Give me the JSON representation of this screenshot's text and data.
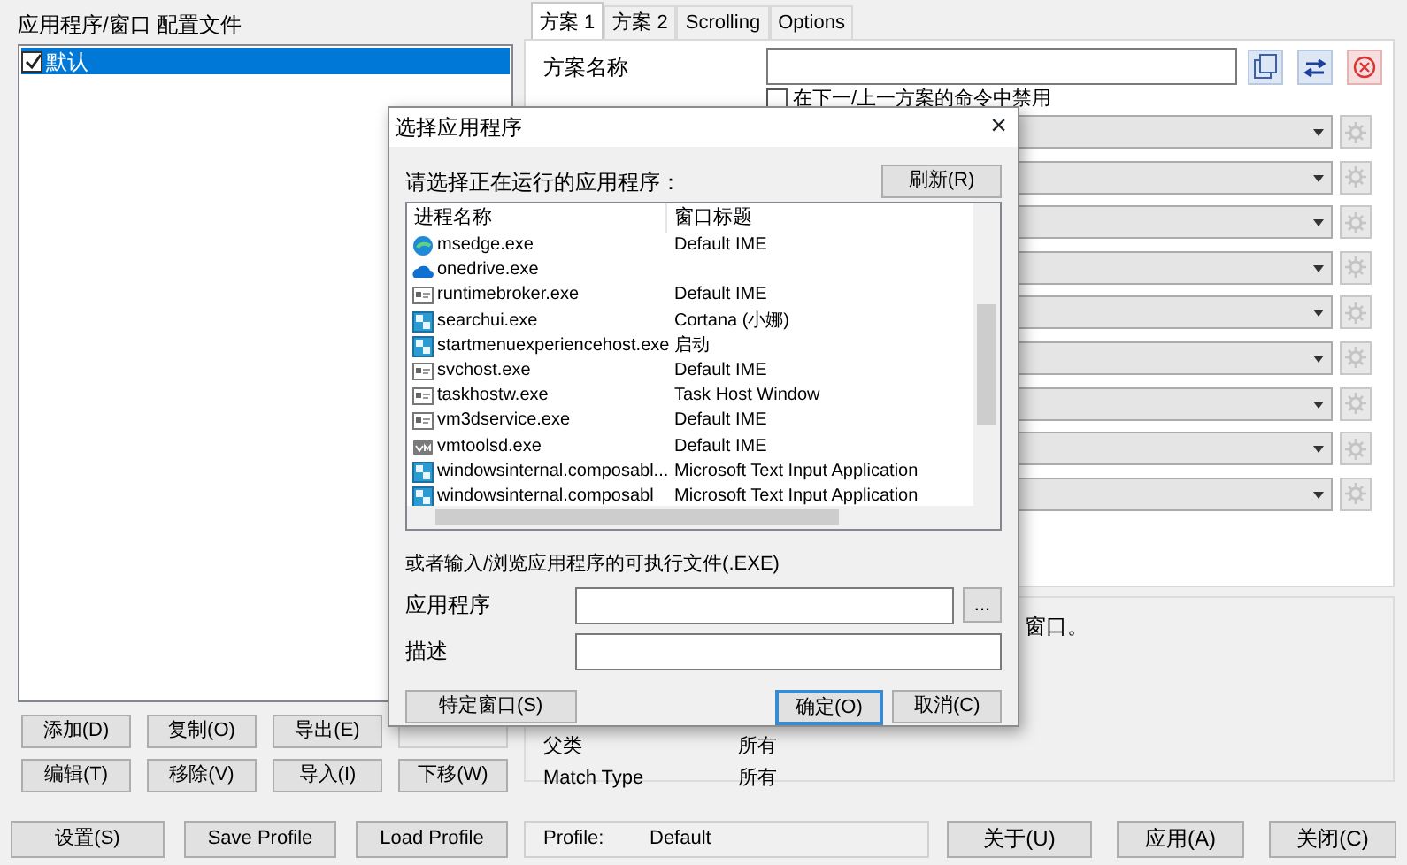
{
  "left_panel": {
    "title": "应用程序/窗口 配置文件",
    "profiles": [
      {
        "label": "默认",
        "checked": true,
        "selected": true
      }
    ],
    "buttons": [
      {
        "label": "添加(D)",
        "disabled": false
      },
      {
        "label": "复制(O)",
        "disabled": false
      },
      {
        "label": "导出(E)",
        "disabled": false
      },
      {
        "disabled": true
      },
      {
        "label": "编辑(T)",
        "disabled": false
      },
      {
        "label": "移除(V)",
        "disabled": false
      },
      {
        "label": "导入(I)",
        "disabled": false
      },
      {
        "label": "下移(W)",
        "disabled": false
      }
    ]
  },
  "tabs": [
    {
      "label": "方案 1",
      "selected": true
    },
    {
      "label": "方案 2",
      "selected": false
    },
    {
      "label": "Scrolling",
      "selected": false
    },
    {
      "label": "Options",
      "selected": false
    }
  ],
  "scheme": {
    "name_label": "方案名称",
    "disable_option": {
      "label": "在下一/上一方案的命令中禁用",
      "checked": false
    },
    "action_rows": [
      {
        "gear_disabled": true
      },
      {
        "gear_disabled": true
      },
      {
        "gear_disabled": true
      },
      {
        "gear_disabled": true
      },
      {
        "gear_disabled": true
      },
      {
        "gear_disabled": true
      },
      {
        "gear_disabled": true
      },
      {
        "gear_disabled": true
      },
      {
        "gear_disabled": true
      }
    ]
  },
  "details": {
    "note": "窗口。",
    "fields": [
      {
        "label": "父类",
        "value": "所有"
      },
      {
        "label": "Match Type",
        "value": "所有"
      }
    ]
  },
  "bottom_left_buttons": [
    "设置(S)",
    "Save Profile",
    "Load Profile"
  ],
  "status": {
    "label": "Profile:",
    "value": "Default"
  },
  "bottom_right_buttons": [
    "关于(U)",
    "应用(A)",
    "关闭(C)"
  ],
  "dialog": {
    "title": "选择应用程序",
    "close": "×",
    "prompt": "请选择正在运行的应用程序：",
    "refresh": "刷新(R)",
    "columns": [
      "进程名称",
      "窗口标题"
    ],
    "processes": [
      {
        "kind": "edge",
        "name": "msedge.exe",
        "title": "Default IME"
      },
      {
        "kind": "cloud",
        "name": "onedrive.exe"
      },
      {
        "kind": "window",
        "name": "runtimebroker.exe",
        "title": "Default IME"
      },
      {
        "kind": "tile",
        "name": "searchui.exe",
        "title": "Cortana (小娜)"
      },
      {
        "kind": "tile",
        "name": "startmenuexperiencehost.exe",
        "title": "启动"
      },
      {
        "kind": "window",
        "name": "svchost.exe",
        "title": "Default IME"
      },
      {
        "kind": "window",
        "name": "taskhostw.exe",
        "title": "Task Host Window"
      },
      {
        "kind": "window",
        "name": "vm3dservice.exe",
        "title": "Default IME"
      },
      {
        "kind": "vm",
        "name": "vmtoolsd.exe",
        "title": "Default IME"
      },
      {
        "kind": "tile",
        "name": "windowsinternal.composabl...",
        "title": "Microsoft Text Input Application"
      },
      {
        "kind": "tile",
        "name": "windowsinternal.composabl",
        "title": "Microsoft Text Input Application"
      }
    ],
    "browse_label": "或者输入/浏览应用程序的可执行文件(.EXE)",
    "app_label": "应用程序",
    "browse_button": "...",
    "desc_label": "描述",
    "specific_button": "特定窗口(S)",
    "ok_button": "确定(O)",
    "cancel_button": "取消(C)"
  }
}
